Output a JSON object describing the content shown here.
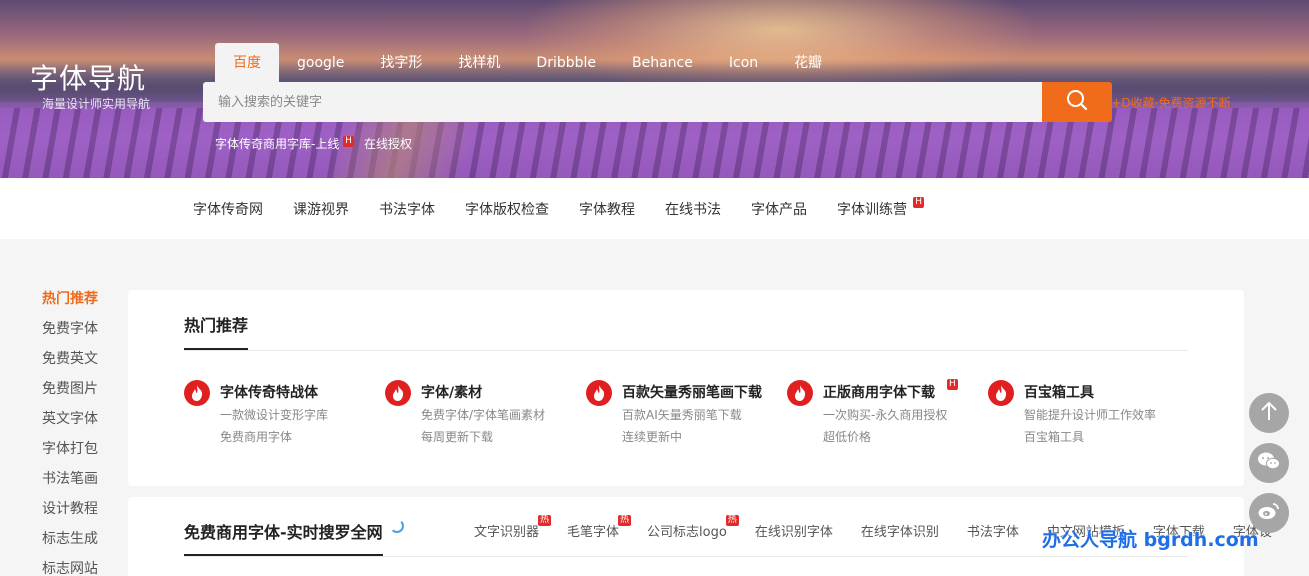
{
  "header": {
    "logo_title": "字体导航",
    "logo_subtitle": "海量设计师实用导航",
    "tabs": [
      {
        "label": "百度",
        "active": true
      },
      {
        "label": "google",
        "active": false
      },
      {
        "label": "找字形",
        "active": false
      },
      {
        "label": "找样机",
        "active": false
      },
      {
        "label": "Dribbble",
        "active": false
      },
      {
        "label": "Behance",
        "active": false
      },
      {
        "label": "Icon",
        "active": false
      },
      {
        "label": "花瓣",
        "active": false
      }
    ],
    "search_placeholder": "输入搜索的关键字",
    "search_icon": "search-icon",
    "bookmark_text": "Ctrl+D收藏·免费资源不断",
    "hot_words": [
      {
        "label": "字体传奇商用字库-上线",
        "badge": "H"
      },
      {
        "label": "在线授权",
        "badge": ""
      }
    ]
  },
  "nav": {
    "items": [
      {
        "label": "字体传奇网",
        "badge": ""
      },
      {
        "label": "课游视界",
        "badge": ""
      },
      {
        "label": "书法字体",
        "badge": ""
      },
      {
        "label": "字体版权检查",
        "badge": ""
      },
      {
        "label": "字体教程",
        "badge": ""
      },
      {
        "label": "在线书法",
        "badge": ""
      },
      {
        "label": "字体产品",
        "badge": ""
      },
      {
        "label": "字体训练营",
        "badge": "H"
      }
    ]
  },
  "sidebar": {
    "items": [
      {
        "label": "热门推荐",
        "active": true
      },
      {
        "label": "免费字体",
        "active": false
      },
      {
        "label": "免费英文",
        "active": false
      },
      {
        "label": "免费图片",
        "active": false
      },
      {
        "label": "英文字体",
        "active": false
      },
      {
        "label": "字体打包",
        "active": false
      },
      {
        "label": "书法笔画",
        "active": false
      },
      {
        "label": "设计教程",
        "active": false
      },
      {
        "label": "标志生成",
        "active": false
      },
      {
        "label": "标志网站",
        "active": false
      }
    ]
  },
  "hot_section": {
    "title": "热门推荐",
    "items": [
      {
        "title": "字体传奇特战体",
        "desc1": "一款微设计变形字库",
        "desc2": "免费商用字体",
        "badge": ""
      },
      {
        "title": "字体/素材",
        "desc1": "免费字体/字体笔画素材",
        "desc2": "每周更新下载",
        "badge": ""
      },
      {
        "title": "百款矢量秀丽笔画下载",
        "desc1": "百款AI矢量秀丽笔下载",
        "desc2": "连续更新中",
        "badge": ""
      },
      {
        "title": "正版商用字体下载",
        "desc1": "一次购买-永久商用授权",
        "desc2": "超低价格",
        "badge": "H"
      },
      {
        "title": "百宝箱工具",
        "desc1": "智能提升设计师工作效率",
        "desc2": "百宝箱工具",
        "badge": ""
      }
    ],
    "item_icon": "fire-icon"
  },
  "free_section": {
    "title": "免费商用字体-实时搜罗全网",
    "links": [
      {
        "label": "文字识别器",
        "badge": "热"
      },
      {
        "label": "毛笔字体",
        "badge": "热"
      },
      {
        "label": "公司标志logo",
        "badge": "热"
      },
      {
        "label": "在线识别字体",
        "badge": ""
      },
      {
        "label": "在线字体识别",
        "badge": ""
      },
      {
        "label": "书法字体",
        "badge": ""
      },
      {
        "label": "中文网站模板",
        "badge": ""
      },
      {
        "label": "字体下载",
        "badge": ""
      },
      {
        "label": "字体设",
        "badge": ""
      }
    ]
  },
  "floating": {
    "icons": [
      "arrow-up-icon",
      "wechat-icon",
      "weibo-icon"
    ]
  },
  "watermark": "办公人导航 bgrdh.com",
  "colors": {
    "accent": "#f06c1b",
    "hot_red": "#e02020",
    "watermark_blue": "#1e6ee8"
  }
}
